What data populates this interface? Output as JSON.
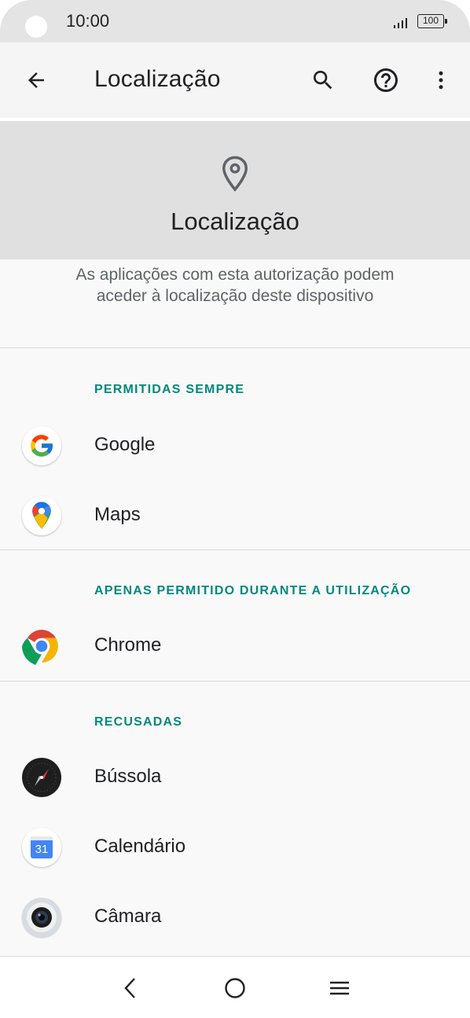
{
  "status_bar": {
    "time": "10:00",
    "battery": "100"
  },
  "app_bar": {
    "title": "Localização"
  },
  "header": {
    "title": "Localização"
  },
  "description": "As aplicações com esta autorização podem aceder à localização deste dispositivo",
  "sections": [
    {
      "header": "PERMITIDAS SEMPRE",
      "apps": [
        "Google",
        "Maps"
      ]
    },
    {
      "header": "APENAS PERMITIDO DURANTE A UTILIZAÇÃO",
      "apps": [
        "Chrome"
      ]
    },
    {
      "header": "RECUSADAS",
      "apps": [
        "Bússola",
        "Calendário",
        "Câmara"
      ]
    }
  ],
  "calendar_day": "31",
  "icons": {
    "back": "arrow-left-icon",
    "search": "search-icon",
    "help": "help-circle-icon",
    "more": "more-vert-icon",
    "header": "location-pin-icon",
    "nav_back": "chevron-left-icon",
    "nav_home": "circle-home-icon",
    "nav_menu": "menu-lines-icon"
  },
  "colors": {
    "accent": "#00897b",
    "header_bg": "#e0e0e0",
    "app_bar_bg": "#f5f5f5"
  }
}
